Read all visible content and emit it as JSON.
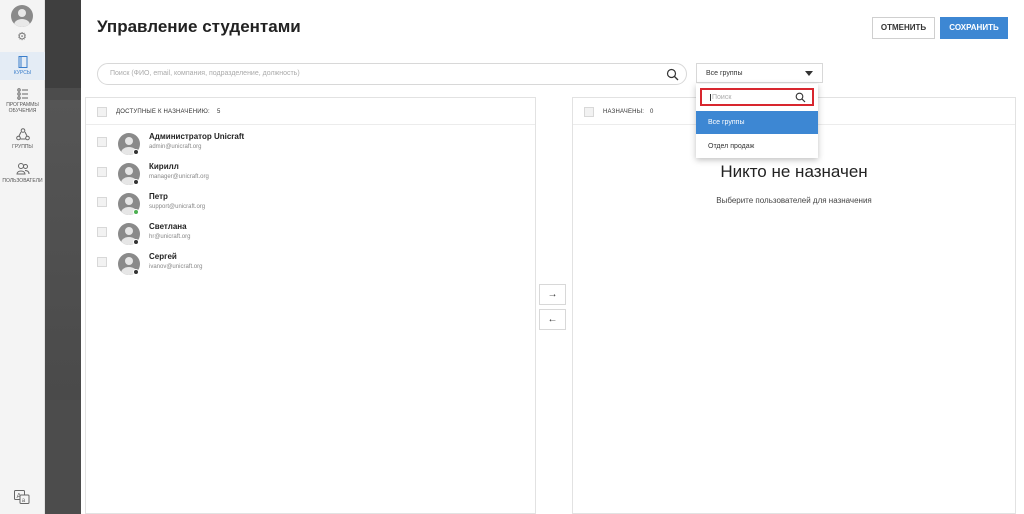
{
  "nav": {
    "items": [
      {
        "label": "КУРСЫ"
      },
      {
        "label1": "ПРОГРАММЫ",
        "label2": "ОБУЧЕНИЯ"
      },
      {
        "label": "ГРУППЫ"
      },
      {
        "label": "ПОЛЬЗОВАТЕЛИ"
      }
    ]
  },
  "header": {
    "title": "Управление студентами",
    "cancel_label": "ОТМЕНИТЬ",
    "save_label": "СОХРАНИТЬ"
  },
  "search": {
    "placeholder": "Поиск (ФИО, email, компания, подразделение, должность)"
  },
  "group_filter": {
    "selected": "Все группы",
    "search_placeholder": "Поиск",
    "options": [
      "Все группы",
      "Отдел продаж"
    ]
  },
  "available": {
    "label": "ДОСТУПНЫЕ К НАЗНАЧЕНИЮ:",
    "count": "5",
    "users": [
      {
        "name": "Администратор Unicraft",
        "email": "admin@unicraft.org",
        "status": "offline"
      },
      {
        "name": "Кирилл",
        "email": "manager@unicraft.org",
        "status": "offline"
      },
      {
        "name": "Петр",
        "email": "support@unicraft.org",
        "status": "online"
      },
      {
        "name": "Светлана",
        "email": "hr@unicraft.org",
        "status": "offline"
      },
      {
        "name": "Сергей",
        "email": "ivanov@unicraft.org",
        "status": "offline"
      }
    ]
  },
  "assigned": {
    "label": "НАЗНАЧЕНЫ:",
    "count": "0",
    "empty_title": "Никто не назначен",
    "empty_subtitle": "Выберите пользователей для назначения"
  },
  "transfer": {
    "right": "→",
    "left": "←"
  },
  "colors": {
    "accent": "#3d87d3",
    "highlight": "#d8262e",
    "online": "#4caf50",
    "offline": "#333333"
  }
}
